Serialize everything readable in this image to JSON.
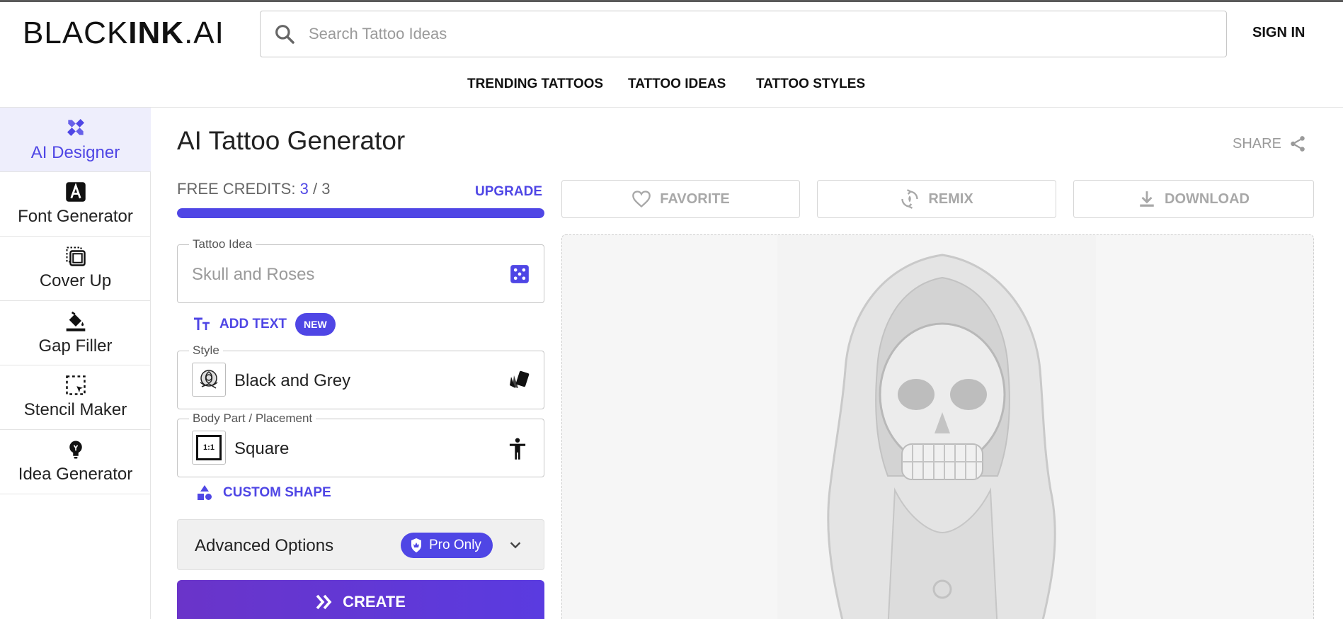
{
  "header": {
    "logo_light": "BLACK",
    "logo_bold": "INK",
    "logo_suffix": ".AI",
    "search_placeholder": "Search Tattoo Ideas",
    "sign_in": "SIGN IN",
    "nav": [
      "TRENDING TATTOOS",
      "TATTOO IDEAS",
      "TATTOO STYLES"
    ]
  },
  "sidebar": {
    "items": [
      {
        "label": "AI Designer",
        "icon": "pencil-ruler-icon",
        "active": true
      },
      {
        "label": "Font Generator",
        "icon": "font-a-icon",
        "active": false
      },
      {
        "label": "Cover Up",
        "icon": "cover-up-icon",
        "active": false
      },
      {
        "label": "Gap Filler",
        "icon": "paint-bucket-icon",
        "active": false
      },
      {
        "label": "Stencil Maker",
        "icon": "stencil-select-icon",
        "active": false
      },
      {
        "label": "Idea Generator",
        "icon": "lightbulb-icon",
        "active": false
      }
    ]
  },
  "main": {
    "title": "AI Tattoo Generator",
    "share": "SHARE",
    "credits": {
      "label": "FREE CREDITS:",
      "used": "3",
      "separator": "/",
      "total": "3",
      "upgrade": "UPGRADE",
      "progress": 1.0
    },
    "tattoo_idea": {
      "legend": "Tattoo Idea",
      "placeholder": "Skull and Roses"
    },
    "add_text": {
      "label": "ADD TEXT",
      "badge": "NEW"
    },
    "style": {
      "legend": "Style",
      "value": "Black and Grey"
    },
    "placement": {
      "legend": "Body Part / Placement",
      "value": "Square",
      "thumb_text": "1:1"
    },
    "custom_shape": "CUSTOM SHAPE",
    "advanced": {
      "label": "Advanced Options",
      "pro": "Pro Only"
    },
    "create": "CREATE",
    "actions": {
      "favorite": "FAVORITE",
      "remix": "REMIX",
      "download": "DOWNLOAD"
    }
  },
  "colors": {
    "accent": "#4f46e5",
    "active_bg": "#eeeefc",
    "muted": "#a8a8a8"
  }
}
